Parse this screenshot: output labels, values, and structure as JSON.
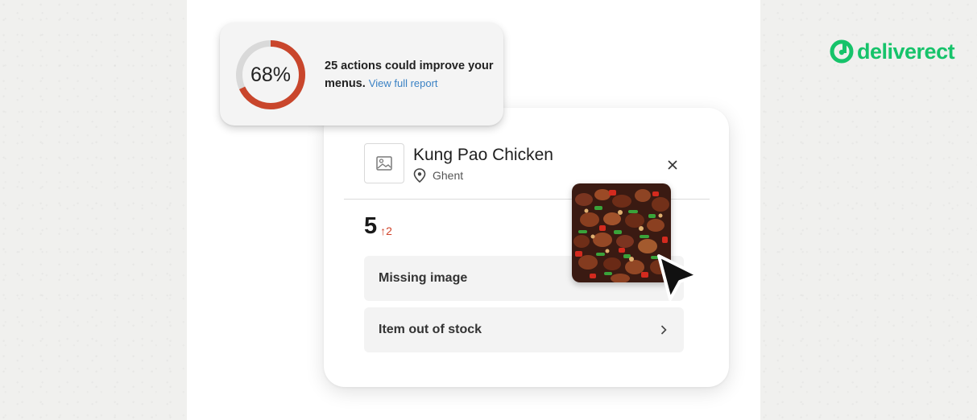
{
  "brand": {
    "name": "deliverect",
    "color": "#16c36a"
  },
  "score_card": {
    "percent_label": "68%",
    "percent_value": 68,
    "ring_color": "#c9462c",
    "ring_track_color": "#d9d9d9",
    "message": "25 actions could improve your menus.",
    "link_label": "View full report"
  },
  "item_card": {
    "title": "Kung Pao Chicken",
    "location": "Ghent",
    "image_placeholder_icon": "image-icon",
    "location_icon": "map-pin-icon",
    "close_icon": "close-icon",
    "count": "5",
    "delta": "↑2",
    "delta_color": "#d0432a",
    "actions": [
      {
        "label": "Missing image"
      },
      {
        "label": "Item out of stock",
        "icon": "chevron-right-icon"
      }
    ]
  },
  "overlay": {
    "food_image": "kung-pao-chicken-photo",
    "pointer_icon": "cursor-arrow-icon"
  }
}
